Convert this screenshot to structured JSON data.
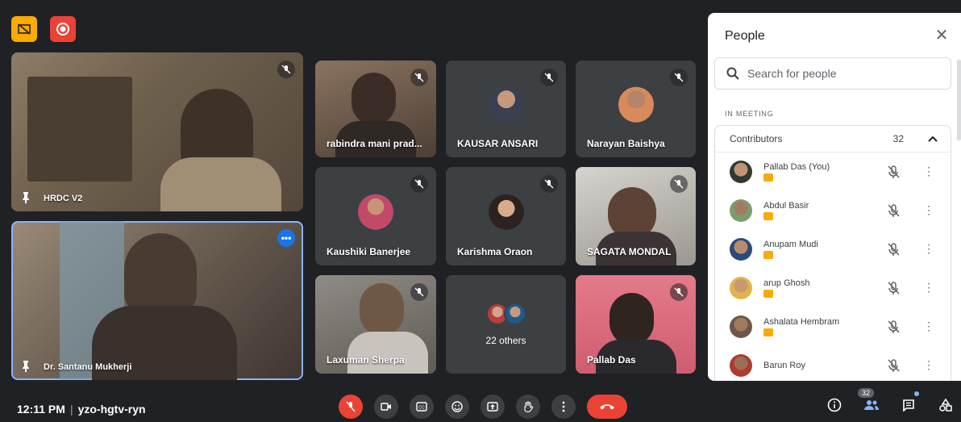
{
  "top_bar": {
    "icons": [
      "no-presenter-icon",
      "record-icon"
    ]
  },
  "tiles": [
    {
      "name": "HRDC V2",
      "type": "video",
      "pinned": true,
      "mic_off": true
    },
    {
      "name": "Dr. Santanu Mukherji",
      "type": "video",
      "pinned": true,
      "active": true
    },
    {
      "name": "rabindra mani prad...",
      "type": "video",
      "mic_off": true
    },
    {
      "name": "KAUSAR ANSARI",
      "type": "avatar",
      "mic_off": true
    },
    {
      "name": "Narayan Baishya",
      "type": "avatar",
      "mic_off": true
    },
    {
      "name": "Kaushiki Banerjee",
      "type": "avatar",
      "mic_off": true
    },
    {
      "name": "Karishma Oraon",
      "type": "avatar",
      "mic_off": true
    },
    {
      "name": "SAGATA MONDAL",
      "type": "video",
      "mic_off": true
    },
    {
      "name": "Laxuman Sherpa",
      "type": "video",
      "mic_off": true
    },
    {
      "name": "22 others",
      "type": "others"
    },
    {
      "name": "Pallab Das",
      "type": "video",
      "mic_off": true
    }
  ],
  "panel": {
    "title": "People",
    "search_placeholder": "Search for people",
    "section_label": "IN MEETING",
    "group_label": "Contributors",
    "group_count": "32",
    "people": [
      {
        "name": "Pallab Das (You)",
        "presenting": true
      },
      {
        "name": "Abdul Basir",
        "presenting": true
      },
      {
        "name": "Anupam Mudi",
        "presenting": true
      },
      {
        "name": "arup Ghosh",
        "presenting": true
      },
      {
        "name": "Ashalata Hembram",
        "presenting": true
      },
      {
        "name": "Barun Roy",
        "presenting": false
      }
    ]
  },
  "bottom_bar": {
    "time": "12:11 PM",
    "meeting_code": "yzo-hgtv-ryn",
    "people_count": "32"
  },
  "colors": {
    "accent": "#1a73e8",
    "danger": "#ea4335",
    "present": "#f9ab00",
    "background": "#202124",
    "tile": "#3c4043"
  }
}
